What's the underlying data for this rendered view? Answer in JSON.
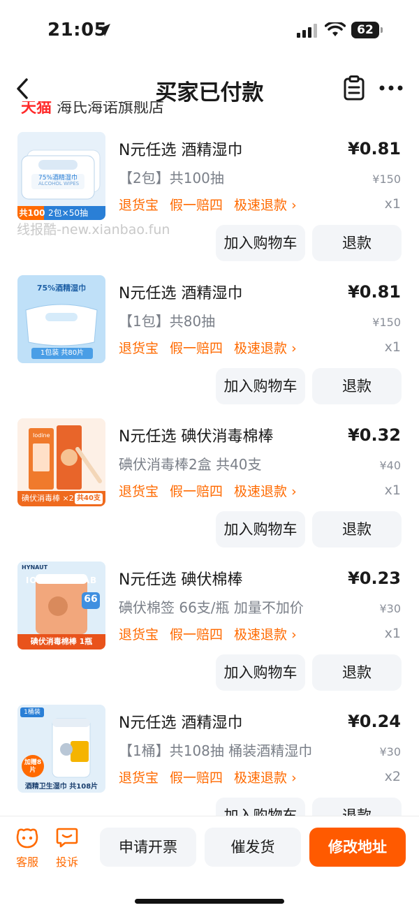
{
  "status": {
    "time": "21:05",
    "battery": "62"
  },
  "nav": {
    "title": "买家已付款"
  },
  "watermark": "线报酷-new.xianbao.fun",
  "services": [
    "退货宝",
    "假一赔四",
    "极速退款 ›"
  ],
  "buttons": {
    "add_cart": "加入购物车",
    "refund": "退款"
  },
  "items": [
    {
      "title": "N元任选 酒精湿巾",
      "spec": "【2包】共100抽",
      "price": "¥0.81",
      "orig": "¥150",
      "qty": "x1",
      "thumb": {
        "tag": "共100抽",
        "label": "2包×50抽",
        "brand": "75%酒精湿巾",
        "sub": "ALCOHOL WIPES"
      }
    },
    {
      "title": "N元任选 酒精湿巾",
      "spec": "【1包】共80抽",
      "price": "¥0.81",
      "orig": "¥150",
      "qty": "x1",
      "thumb": {
        "top": "75%酒精湿巾",
        "label": "1包装  共80片"
      }
    },
    {
      "title": "N元任选 碘伏消毒棉棒",
      "spec": "碘伏消毒棒2盒 共40支",
      "price": "¥0.32",
      "orig": "¥40",
      "qty": "x1",
      "thumb": {
        "brand": "Iodine",
        "label": "碘伏消毒棒 ×2",
        "count": "共40支"
      }
    },
    {
      "title": "N元任选 碘伏棉棒",
      "spec": "碘伏棉签 66支/瓶 加量不加价",
      "price": "¥0.23",
      "orig": "¥30",
      "qty": "x1",
      "thumb": {
        "brand": "HYNAUT",
        "text": "IODINE SWAB",
        "num": "66",
        "label": "碘伏消毒棉棒 1瓶"
      }
    },
    {
      "title": "N元任选 酒精湿巾",
      "spec": "【1桶】共108抽 桶装酒精湿巾",
      "price": "¥0.24",
      "orig": "¥30",
      "qty": "x2",
      "thumb": {
        "tag": "1桶装",
        "badge": "加赠8片",
        "label": "酒精卫生湿巾  共108片"
      }
    }
  ],
  "peek": {
    "red": "天猫",
    "rest": " 海氏海诺旗舰店"
  },
  "bottom": {
    "service": "客服",
    "complaint": "投诉",
    "invoice": "申请开票",
    "urge": "催发货",
    "address": "修改地址"
  },
  "colors": {
    "accent": "#ff5a00",
    "service_text": "#ff6a00"
  }
}
